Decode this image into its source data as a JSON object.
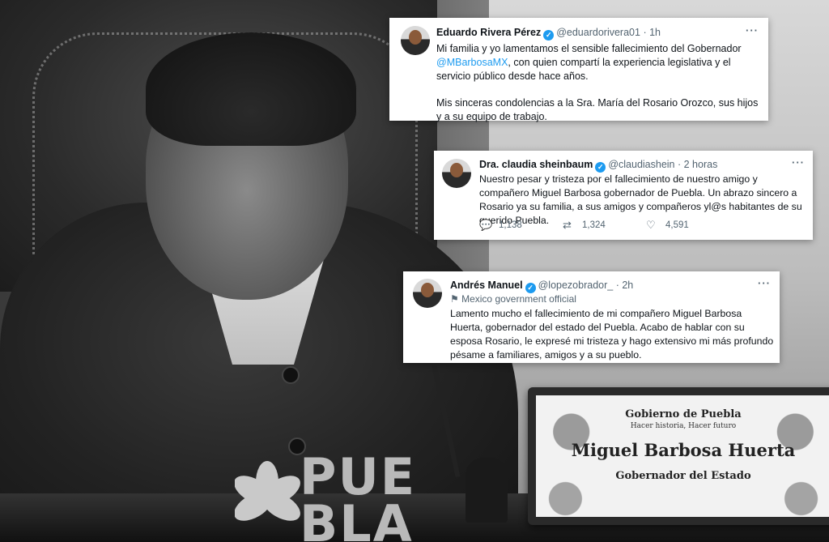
{
  "photo": {
    "logo_text_line1": "PUE",
    "logo_text_line2": "BLA"
  },
  "nameplate": {
    "line1": "Gobierno de Puebla",
    "line2": "Hacer historia, Hacer futuro",
    "name": "Miguel Barbosa Huerta",
    "role": "Gobernador del Estado"
  },
  "tweets": [
    {
      "name": "Eduardo Rivera Pérez",
      "handle": "@eduardorivera01",
      "time": "· 1h",
      "text_before_mention": "Mi familia y yo lamentamos el sensible fallecimiento del Gobernador ",
      "mention": "@MBarbosaMX",
      "text_after_mention": ", con quien compartí la experiencia legislativa y el servicio público desde hace años.",
      "paragraph2": "Mis sinceras condolencias a la Sra. María del Rosario Orozco, sus hijos y a su equipo de trabajo."
    },
    {
      "name": "Dra. claudia sheinbaum",
      "handle": "@claudiashein",
      "time": "· 2 horas",
      "text": "Nuestro pesar y tristeza por el fallecimiento de nuestro amigo y compañero Miguel Barbosa gobernador de Puebla. Un abrazo sincero a Rosario ya su familia, a sus amigos y compañeros yl@s habitantes de su querido Puebla.",
      "replies": "1,138",
      "retweets": "1,324",
      "likes": "4,591"
    },
    {
      "name": "Andrés Manuel",
      "handle": "@lopezobrador_",
      "time": "· 2h",
      "label": "Mexico government official",
      "text": "Lamento mucho el fallecimiento de mi compañero Miguel Barbosa Huerta, gobernador del estado del Puebla. Acabo de hablar con su esposa Rosario, le expresé mi tristeza y hago extensivo mi más profundo pésame a familiares, amigos y a su pueblo."
    }
  ],
  "icons": {
    "verified": "verified-badge-icon",
    "more": "more-icon",
    "reply": "reply-icon",
    "retweet": "retweet-icon",
    "like": "like-icon",
    "flag": "flag-icon"
  },
  "colors": {
    "verified": "#1d9bf0",
    "link": "#1d9bf0",
    "secondary_text": "#536471"
  }
}
